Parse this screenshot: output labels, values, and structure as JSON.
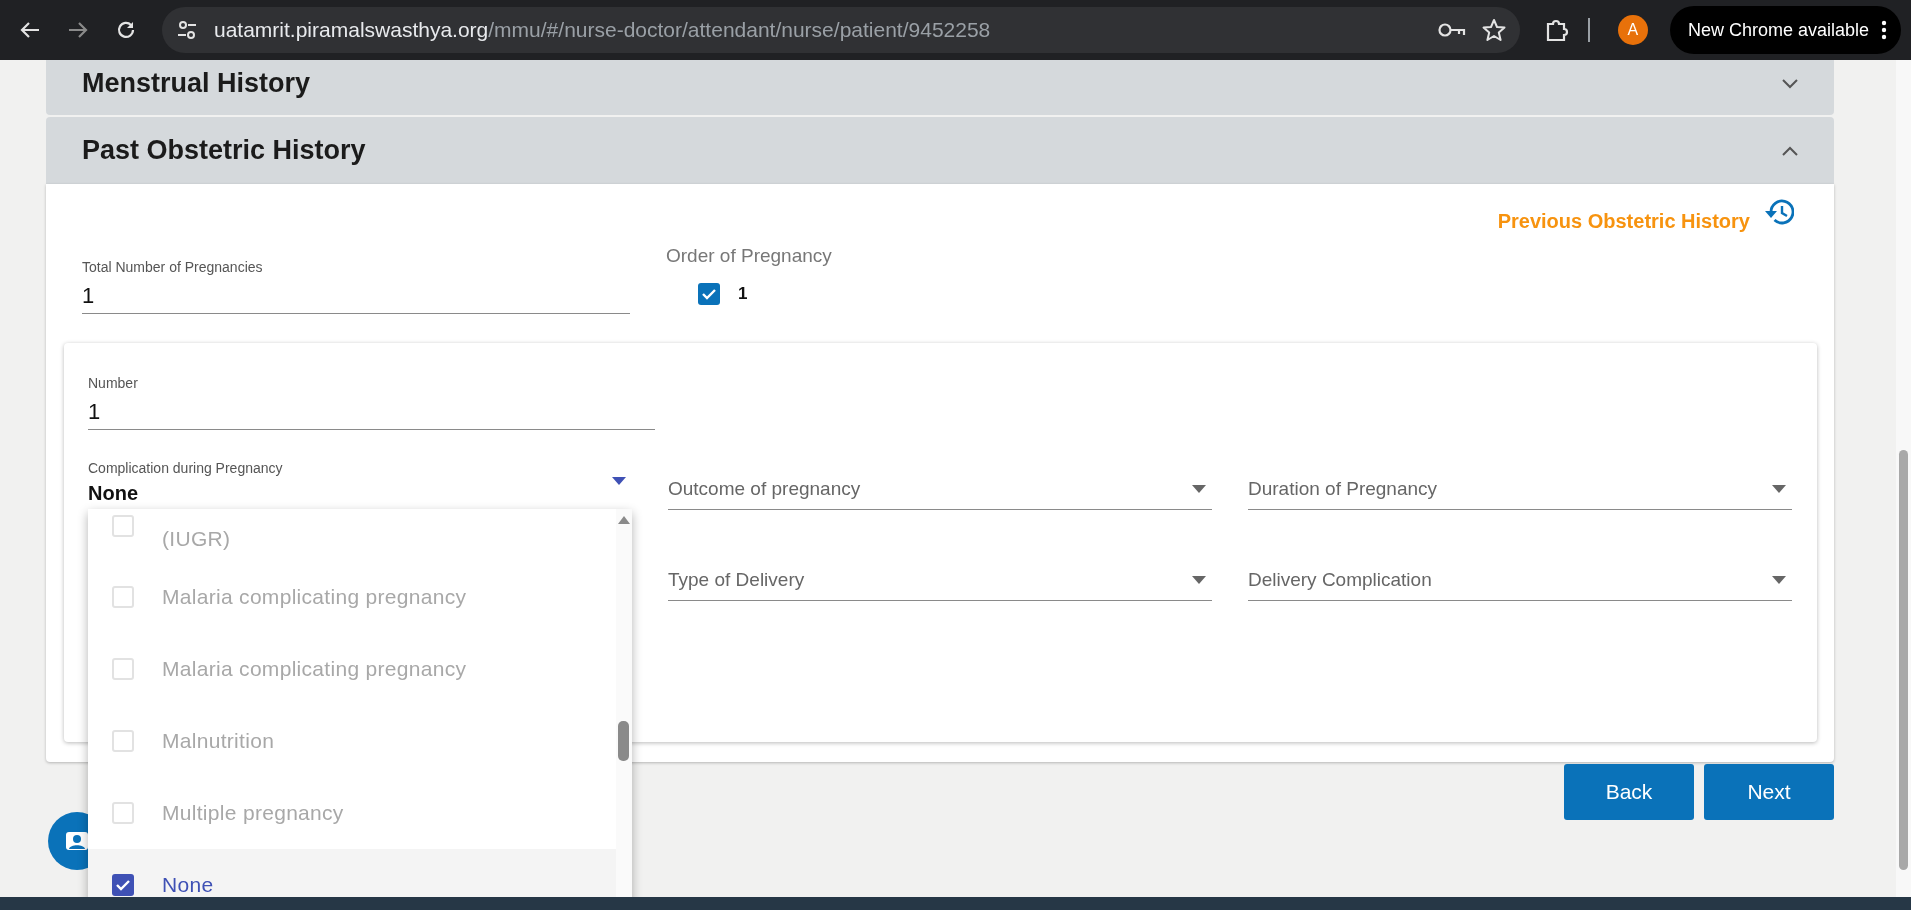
{
  "browser": {
    "url_host": "uatamrit.piramalswasthya.org",
    "url_path": "/mmu/#/nurse-doctor/attendant/nurse/patient/9452258",
    "profile_initial": "A",
    "update_button": "New Chrome available"
  },
  "sections": [
    {
      "title": "Menstrual History",
      "expanded": false
    },
    {
      "title": "Past Obstetric History",
      "expanded": true
    }
  ],
  "previous_history_link": "Previous Obstetric History",
  "total_pregnancies": {
    "label": "Total Number of Pregnancies",
    "value": "1"
  },
  "order_of_pregnancy": {
    "label": "Order of Pregnancy",
    "options": [
      {
        "label": "1",
        "checked": true
      }
    ]
  },
  "record": {
    "number": {
      "label": "Number",
      "value": "1"
    },
    "complication": {
      "label": "Complication during Pregnancy",
      "value": "None",
      "expanded": true,
      "options": [
        {
          "label": "(IUGR)",
          "checked": false,
          "disabled": true
        },
        {
          "label": "Malaria complicating pregnancy",
          "checked": false,
          "disabled": true
        },
        {
          "label": "Malaria complicating pregnancy",
          "checked": false,
          "disabled": true
        },
        {
          "label": "Malnutrition",
          "checked": false,
          "disabled": true
        },
        {
          "label": "Multiple pregnancy",
          "checked": false,
          "disabled": true
        },
        {
          "label": "None",
          "checked": true,
          "disabled": false
        }
      ]
    },
    "selects": [
      {
        "placeholder": "Outcome of pregnancy"
      },
      {
        "placeholder": "Duration of Pregnancy"
      },
      {
        "placeholder": "Type of Delivery"
      },
      {
        "placeholder": "Delivery Complication"
      }
    ]
  },
  "buttons": [
    {
      "label": "Back"
    },
    {
      "label": "Next"
    }
  ]
}
